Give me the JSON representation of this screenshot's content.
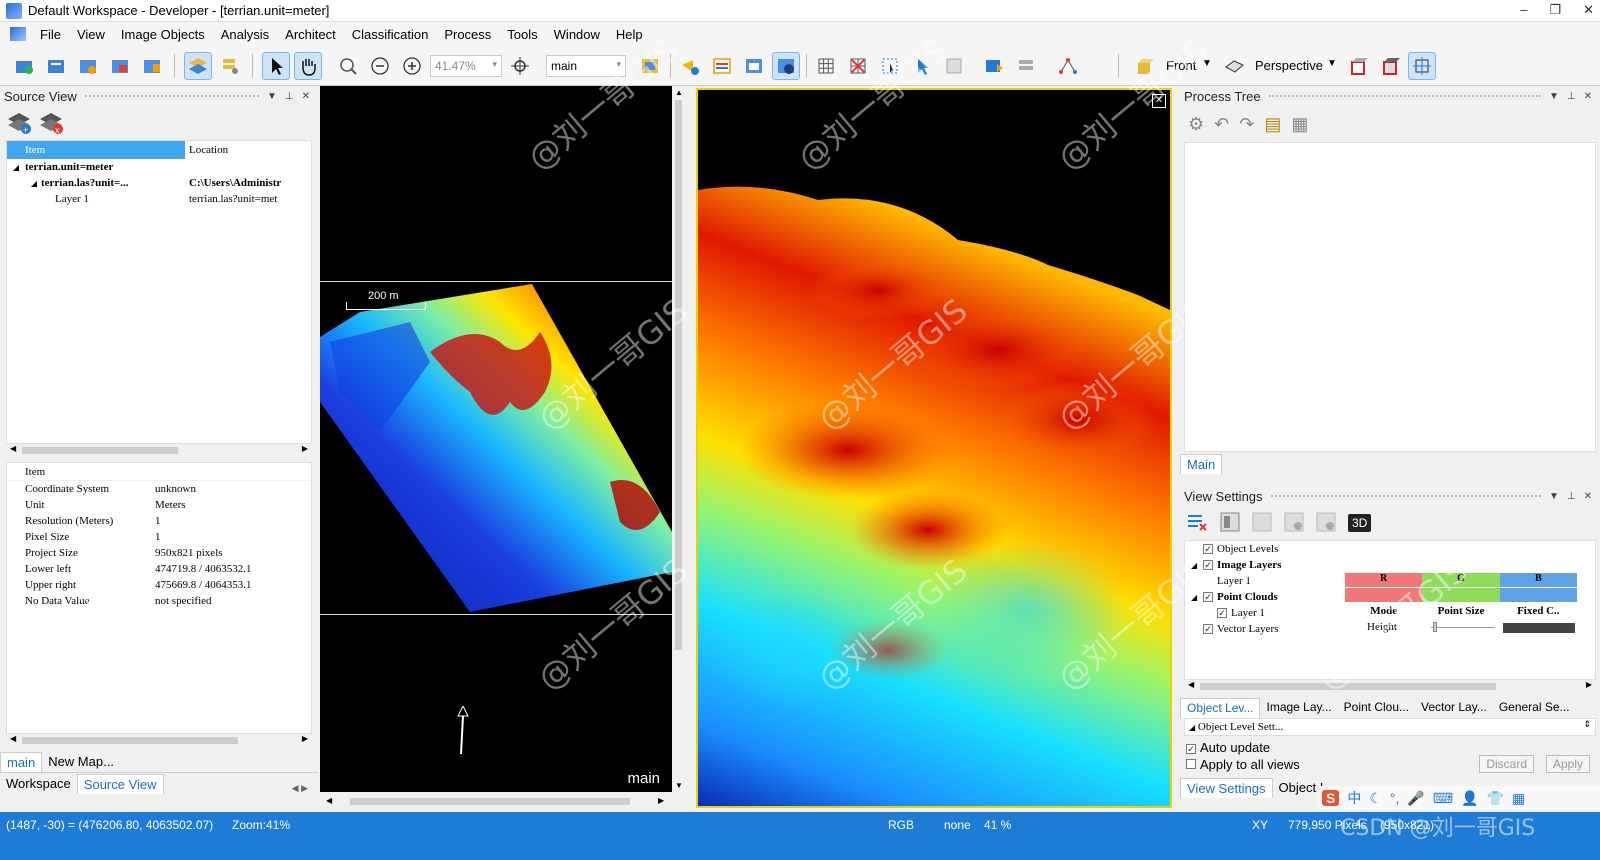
{
  "title": "Default Workspace - Developer - [terrian.unit=meter]",
  "window_controls": {
    "minimize": "–",
    "restore": "❐",
    "close": "✕"
  },
  "menu": [
    "File",
    "View",
    "Image Objects",
    "Analysis",
    "Architect",
    "Classification",
    "Process",
    "Tools",
    "Window",
    "Help"
  ],
  "toolbar": {
    "zoom_value": "41.47%",
    "map_select": "main",
    "front_label": "Front",
    "perspective_label": "Perspective"
  },
  "source_view": {
    "title": "Source View",
    "columns": [
      "Item",
      "Location"
    ],
    "tree": [
      {
        "item": "terrian.unit=meter",
        "location": ""
      },
      {
        "item": "terrian.las?unit=...",
        "location": "C:\\Users\\Administr"
      },
      {
        "item": "Layer 1",
        "location": "terrian.las?unit=met"
      }
    ],
    "props_header": "Item",
    "props": [
      {
        "k": "Coordinate System",
        "v": "unknown"
      },
      {
        "k": "Unit",
        "v": "Meters"
      },
      {
        "k": "Resolution (Meters)",
        "v": "1"
      },
      {
        "k": "Pixel Size",
        "v": "1"
      },
      {
        "k": "Project Size",
        "v": "950x821 pixels"
      },
      {
        "k": "Lower left",
        "v": "474719.8 / 4063532.1"
      },
      {
        "k": "Upper right",
        "v": "475669.8 / 4064353.1"
      },
      {
        "k": "No Data Value",
        "v": "not specified"
      }
    ],
    "map_tabs": [
      "main",
      "New Map..."
    ],
    "bottom_tabs": [
      "Workspace",
      "Source View"
    ]
  },
  "map_view": {
    "scale_label": "200 m",
    "map_name": "main"
  },
  "process_tree": {
    "title": "Process Tree",
    "tab": "Main"
  },
  "view_settings": {
    "title": "View Settings",
    "mode_3d": "3D",
    "tree": [
      {
        "label": "Object Levels",
        "checked": true,
        "bold": false
      },
      {
        "label": "Image Layers",
        "checked": true,
        "bold": true
      },
      {
        "label": "Layer 1",
        "checked": false,
        "bold": false
      },
      {
        "label": "Point Clouds",
        "checked": true,
        "bold": true
      },
      {
        "label": "Layer 1",
        "checked": true,
        "bold": false
      },
      {
        "label": "Vector Layers",
        "checked": true,
        "bold": false
      }
    ],
    "rgb": [
      "R",
      "G",
      "B"
    ],
    "pc_cols": [
      "Mode",
      "Point Size",
      "Fixed C.."
    ],
    "pc_mode": "Height",
    "bottom_tabs": [
      "Object Lev...",
      "Image Lay...",
      "Point Clou...",
      "Vector Lay...",
      "General Se..."
    ],
    "dropdown": "Object Level Sett...",
    "auto_update": "Auto update",
    "apply_all": "Apply to all views",
    "discard": "Discard",
    "apply": "Apply",
    "bottom_tabs2": [
      "View Settings",
      "Object I"
    ]
  },
  "status": {
    "coords": "(1487, -30) = (476206.80, 4063502.07)",
    "zoom": "Zoom:41%",
    "rgb": "RGB",
    "none": "none",
    "pct": "41 %",
    "xy": "XY",
    "pixels": "779,950 Pixels",
    "dims": "(950x821)"
  },
  "watermark": "@刘一哥GIS",
  "csdn": "CSDN @刘一哥GIS",
  "colors": {
    "accent": "#1e7bd6",
    "rgb_r": "#f07878",
    "rgb_g": "#8fdc5a",
    "rgb_b": "#5fa2e6",
    "selection": "#3fa6f0"
  }
}
